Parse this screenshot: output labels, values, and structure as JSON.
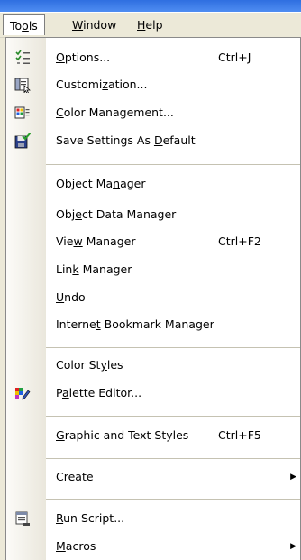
{
  "menubar": {
    "items": [
      {
        "pre": "To",
        "u": "o",
        "post": "ls"
      },
      {
        "pre": "",
        "u": "W",
        "post": "indow"
      },
      {
        "pre": "",
        "u": "H",
        "post": "elp"
      }
    ]
  },
  "menu": {
    "items": [
      {
        "pre": "",
        "u": "O",
        "post": "ptions...",
        "shortcut": "Ctrl+J",
        "icon": "options-icon"
      },
      {
        "pre": "Customi",
        "u": "z",
        "post": "ation...",
        "shortcut": "",
        "icon": "customization-icon"
      },
      {
        "pre": "",
        "u": "C",
        "post": "olor Management...",
        "shortcut": "",
        "icon": "color-management-icon"
      },
      {
        "pre": "Save Settings As ",
        "u": "D",
        "post": "efault",
        "shortcut": "",
        "icon": "save-settings-icon"
      },
      {
        "pre": "Object Ma",
        "u": "n",
        "post": "ager",
        "shortcut": ""
      },
      {
        "pre": "Obj",
        "u": "e",
        "post": "ct Data Manager",
        "shortcut": ""
      },
      {
        "pre": "Vie",
        "u": "w",
        "post": " Manager",
        "shortcut": "Ctrl+F2"
      },
      {
        "pre": "Lin",
        "u": "k",
        "post": " Manager",
        "shortcut": ""
      },
      {
        "pre": "",
        "u": "U",
        "post": "ndo",
        "shortcut": ""
      },
      {
        "pre": "Interne",
        "u": "t",
        "post": " Bookmark Manager",
        "shortcut": ""
      },
      {
        "pre": "Color St",
        "u": "y",
        "post": "les",
        "shortcut": ""
      },
      {
        "pre": "P",
        "u": "a",
        "post": "lette Editor...",
        "shortcut": "",
        "icon": "palette-editor-icon"
      },
      {
        "pre": "",
        "u": "G",
        "post": "raphic and Text Styles",
        "shortcut": "Ctrl+F5"
      },
      {
        "pre": "Crea",
        "u": "t",
        "post": "e",
        "shortcut": "",
        "submenu": "▶"
      },
      {
        "pre": "",
        "u": "R",
        "post": "un Script...",
        "shortcut": "",
        "icon": "run-script-icon"
      },
      {
        "pre": "",
        "u": "M",
        "post": "acros",
        "shortcut": "",
        "submenu": "▶"
      }
    ]
  },
  "colors": {
    "menubar_bg": "#ece9d8",
    "titlebar_blue": "#2f6fe0",
    "icon_strip": "#eae7dc",
    "separator": "#c5c2b2"
  }
}
